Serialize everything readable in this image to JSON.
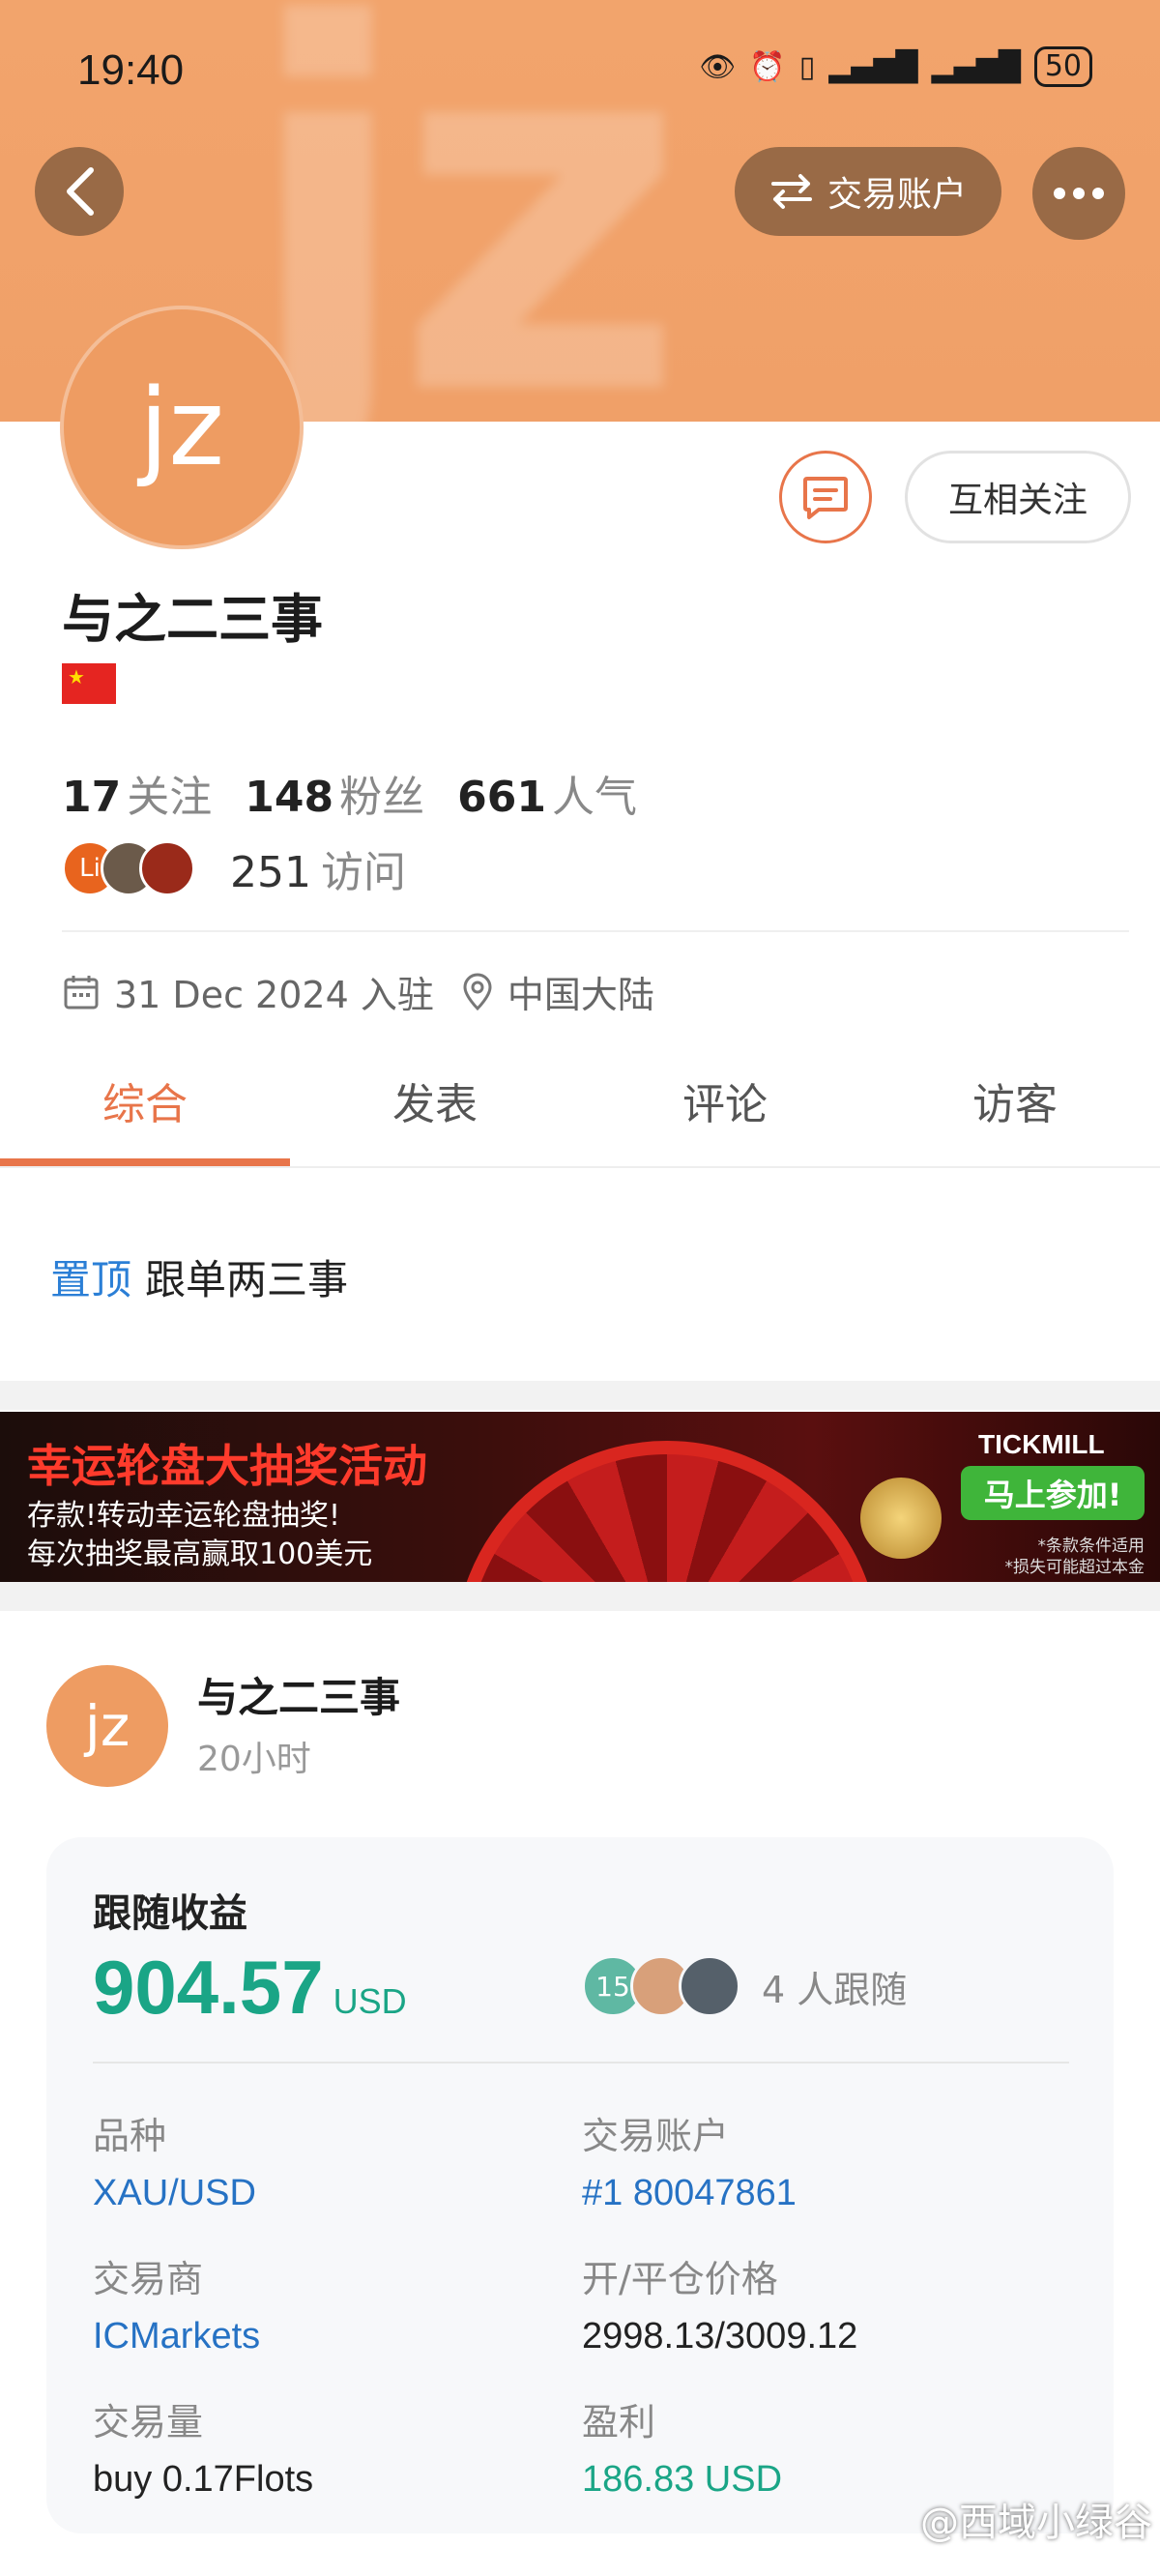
{
  "status_bar": {
    "time": "19:40",
    "battery": "50"
  },
  "header": {
    "bg_text": "jz",
    "switch_label": "交易账户"
  },
  "profile": {
    "avatar_text": "jz",
    "name": "与之二三事",
    "follow_label": "互相关注",
    "stats": [
      {
        "num": "17",
        "label": "关注"
      },
      {
        "num": "148",
        "label": "粉丝"
      },
      {
        "num": "661",
        "label": "人气"
      }
    ],
    "visitor_avatar_text": "Li",
    "visits_num": "251",
    "visits_label": "访问",
    "joined": "31 Dec 2024 入驻",
    "location": "中国大陆"
  },
  "tabs": [
    "综合",
    "发表",
    "评论",
    "访客"
  ],
  "pinned": {
    "tag": "置顶",
    "title": "跟单两三事"
  },
  "banner": {
    "title": "幸运轮盘大抽奖活动",
    "line1": "存款!转动幸运轮盘抽奖!",
    "line2": "每次抽奖最高赢取100美元",
    "brand": "TICKMILL",
    "cta": "马上参加!",
    "note1": "*条款条件适用",
    "note2": "*损失可能超过本金"
  },
  "post": {
    "avatar_text": "jz",
    "author": "与之二三事",
    "time": "20小时",
    "card": {
      "title": "跟随收益",
      "amount": "904.57",
      "currency": "USD",
      "follower_badge": "15",
      "followers_text": "4 人跟随",
      "fields": [
        {
          "label": "品种",
          "value": "XAU/USD",
          "style": "blue"
        },
        {
          "label": "交易账户",
          "value": "#1 80047861",
          "style": "blue"
        },
        {
          "label": "交易商",
          "value": "ICMarkets",
          "style": "blue"
        },
        {
          "label": "开/平仓价格",
          "value": "2998.13/3009.12",
          "style": "plain"
        },
        {
          "label": "交易量",
          "value": "buy 0.17Flots",
          "style": "plain"
        },
        {
          "label": "盈利",
          "value": "186.83 USD",
          "style": "green"
        }
      ]
    }
  },
  "watermark": "@西域小绿谷",
  "colors": {
    "accent": "#e8754a",
    "header_bg": "#f2a46c",
    "profit_green": "#1aa586",
    "link_blue": "#2672c4"
  }
}
